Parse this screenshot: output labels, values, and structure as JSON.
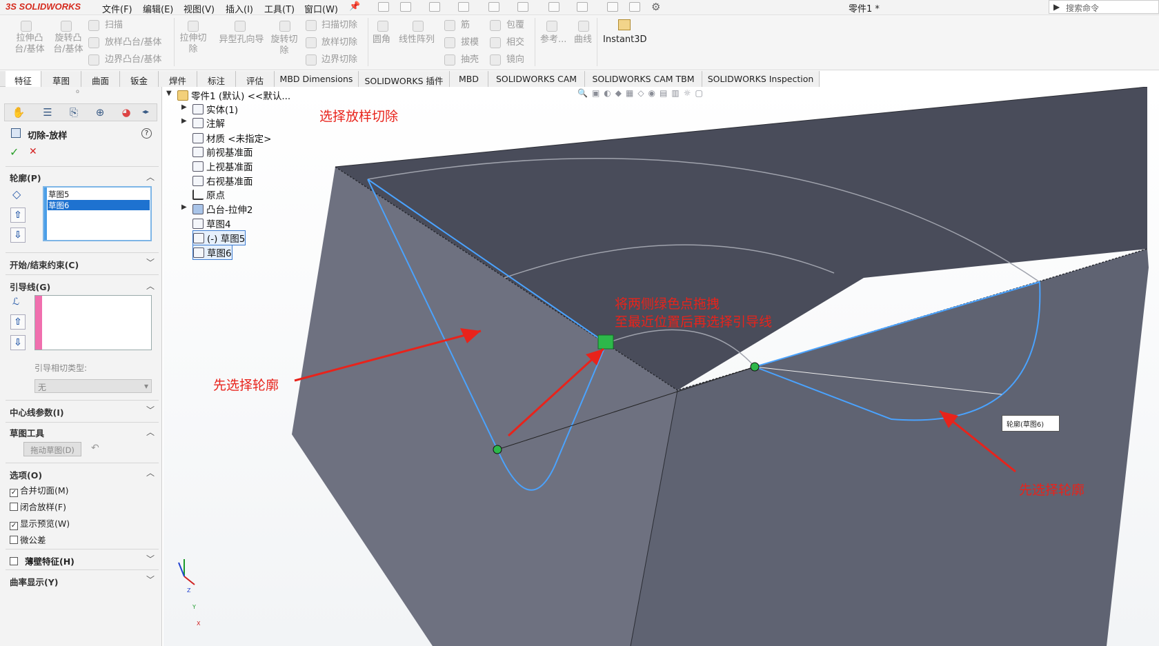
{
  "app": {
    "logo": "SOLIDWORKS",
    "logo_prefix": "3S",
    "document_title": "零件1 *"
  },
  "menu": [
    "文件(F)",
    "编辑(E)",
    "视图(V)",
    "插入(I)",
    "工具(T)",
    "窗口(W)"
  ],
  "search": {
    "placeholder": "搜索命令"
  },
  "ribbon": {
    "boss_extrude": "拉伸凸台/基体",
    "boss_revolve": "旋转凸台/基体",
    "sweep": "扫描",
    "loft_boss": "放样凸台/基体",
    "boundary_boss": "边界凸台/基体",
    "extrude_cut": "拉伸切除",
    "hole_wizard": "异型孔向导",
    "revolve_cut": "旋转切除",
    "sweep_cut": "扫描切除",
    "loft_cut": "放样切除",
    "boundary_cut": "边界切除",
    "fillet": "圆角",
    "linear_pattern": "线性阵列",
    "rib": "筋",
    "draft": "拔模",
    "shell": "抽壳",
    "wrap": "包覆",
    "intersect": "相交",
    "mirror": "镜向",
    "ref_geometry": "参考...",
    "curves": "曲线",
    "instant3d": "Instant3D"
  },
  "tabs": [
    "特征",
    "草图",
    "曲面",
    "钣金",
    "焊件",
    "标注",
    "评估",
    "MBD Dimensions",
    "SOLIDWORKS 插件",
    "MBD",
    "SOLIDWORKS CAM",
    "SOLIDWORKS CAM TBM",
    "SOLIDWORKS Inspection"
  ],
  "property_manager": {
    "title": "切除-放样",
    "help": "?",
    "ok": "✓",
    "cancel": "✕",
    "profiles": {
      "label": "轮廓(P)",
      "items": [
        "草图5",
        "草图6"
      ],
      "selected": "草图6"
    },
    "start_end": {
      "label": "开始/结束约束(C)"
    },
    "guides": {
      "label": "引导线(G)",
      "tangency_label": "引导相切类型:",
      "tangency_value": "无"
    },
    "centerline": {
      "label": "中心线参数(I)"
    },
    "sketch_tools": {
      "label": "草图工具",
      "drag_button": "拖动草图(D)"
    },
    "options": {
      "label": "选项(O)",
      "merge": "合并切面(M)",
      "merge_checked": true,
      "close": "闭合放样(F)",
      "close_checked": false,
      "preview": "显示预览(W)",
      "preview_checked": true,
      "micro": "微公差",
      "micro_checked": false
    },
    "thin": {
      "label": "薄壁特征(H)"
    },
    "curvature": {
      "label": "曲率显示(Y)"
    }
  },
  "tree": {
    "root": "零件1 (默认) <<默认...",
    "items": [
      "实体(1)",
      "注解",
      "材质 <未指定>",
      "前视基准面",
      "上视基准面",
      "右视基准面",
      "原点",
      "凸台-拉伸2",
      "草图4",
      "(-) 草图5",
      "草图6"
    ]
  },
  "annotations": {
    "select_loft_cut": "选择放样切除",
    "drag_points_1": "将两侧绿色点拖拽",
    "drag_points_2": "至最近位置后再选择引导线",
    "select_profile_left": "先选择轮廓",
    "select_profile_right": "先选择轮廓"
  },
  "viewport": {
    "profile_tag": "轮廓(草图6)",
    "triad": {
      "z": "Z",
      "y": "Y",
      "x": "X"
    }
  },
  "colors": {
    "accent_red": "#e8231b",
    "sketch_blue": "#4aa3ff",
    "body_dark": "#4a4e5c",
    "point_green": "#2db84a",
    "selection_blue": "#1e72d0"
  }
}
